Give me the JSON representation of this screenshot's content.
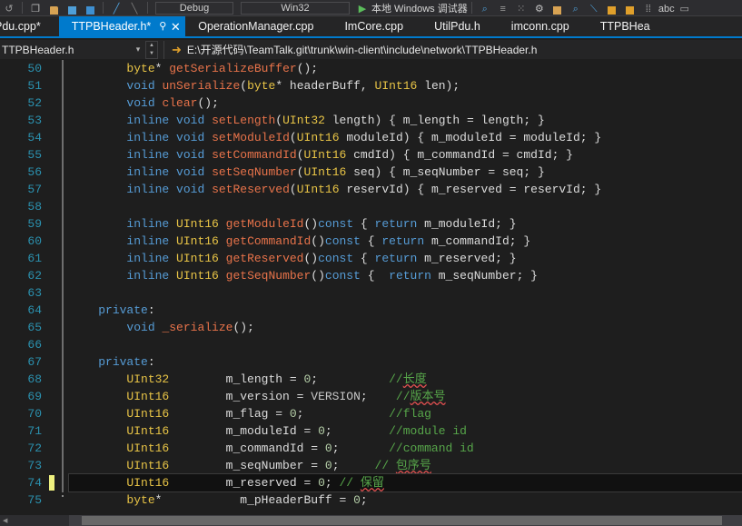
{
  "toolbar": {
    "configuration": "Debug",
    "platform": "Win32",
    "run_label": "本地 Windows 调试器",
    "icons": [
      "undo-icon",
      "redo-icon",
      "open-folder-icon",
      "save-icon",
      "save-all-icon",
      "cut-icon",
      "paste-icon",
      "navigate-backward-icon",
      "navigate-forward-icon",
      "find-icon",
      "bookmark-icon",
      "comment-icon",
      "uncomment-icon",
      "indent-icon",
      "outdent-icon",
      "toggle-whitespace-icon",
      "abc-icon",
      "window-icon"
    ]
  },
  "tabs": {
    "items": [
      {
        "label": "Pdu.cpp*",
        "active": false
      },
      {
        "label": "TTPBHeader.h*",
        "active": true
      },
      {
        "label": "OperationManager.cpp",
        "active": false
      },
      {
        "label": "ImCore.cpp",
        "active": false
      },
      {
        "label": "UtilPdu.h",
        "active": false
      },
      {
        "label": "imconn.cpp",
        "active": false
      },
      {
        "label": "TTPBHea",
        "active": false
      }
    ],
    "pin_glyph": "⚲",
    "close_glyph": "✕"
  },
  "navbar": {
    "file_selector": "TTPBHeader.h",
    "caret_glyph": "▾",
    "arrow_glyph": "➜",
    "path": "E:\\开源代码\\TeamTalk.git\\trunk\\win-client\\include\\network\\TTPBHeader.h"
  },
  "editor": {
    "current_line": 74,
    "first_line": 50,
    "lines": [
      {
        "n": 50,
        "rail": "bar",
        "changed": false,
        "tokens": [
          {
            "t": "        ",
            "c": "t-plain"
          },
          {
            "t": "byte",
            "c": "t-type"
          },
          {
            "t": "* ",
            "c": "t-punc"
          },
          {
            "t": "getSerializeBuffer",
            "c": "t-fn"
          },
          {
            "t": "();",
            "c": "t-punc"
          }
        ]
      },
      {
        "n": 51,
        "rail": "bar",
        "changed": false,
        "tokens": [
          {
            "t": "        ",
            "c": "t-plain"
          },
          {
            "t": "void",
            "c": "t-kw"
          },
          {
            "t": " ",
            "c": "t-plain"
          },
          {
            "t": "unSerialize",
            "c": "t-fn"
          },
          {
            "t": "(",
            "c": "t-punc"
          },
          {
            "t": "byte",
            "c": "t-type"
          },
          {
            "t": "* headerBuff, ",
            "c": "t-id"
          },
          {
            "t": "UInt16",
            "c": "t-type"
          },
          {
            "t": " len);",
            "c": "t-id"
          }
        ]
      },
      {
        "n": 52,
        "rail": "bar",
        "changed": false,
        "tokens": [
          {
            "t": "        ",
            "c": "t-plain"
          },
          {
            "t": "void",
            "c": "t-kw"
          },
          {
            "t": " ",
            "c": "t-plain"
          },
          {
            "t": "clear",
            "c": "t-fn"
          },
          {
            "t": "();",
            "c": "t-punc"
          }
        ]
      },
      {
        "n": 53,
        "rail": "bar",
        "changed": false,
        "tokens": [
          {
            "t": "        ",
            "c": "t-plain"
          },
          {
            "t": "inline",
            "c": "t-kw"
          },
          {
            "t": " ",
            "c": "t-plain"
          },
          {
            "t": "void",
            "c": "t-kw"
          },
          {
            "t": " ",
            "c": "t-plain"
          },
          {
            "t": "setLength",
            "c": "t-fn"
          },
          {
            "t": "(",
            "c": "t-punc"
          },
          {
            "t": "UInt32",
            "c": "t-type"
          },
          {
            "t": " length) { m_length = length; }",
            "c": "t-id"
          }
        ]
      },
      {
        "n": 54,
        "rail": "bar",
        "changed": false,
        "tokens": [
          {
            "t": "        ",
            "c": "t-plain"
          },
          {
            "t": "inline",
            "c": "t-kw"
          },
          {
            "t": " ",
            "c": "t-plain"
          },
          {
            "t": "void",
            "c": "t-kw"
          },
          {
            "t": " ",
            "c": "t-plain"
          },
          {
            "t": "setModuleId",
            "c": "t-fn"
          },
          {
            "t": "(",
            "c": "t-punc"
          },
          {
            "t": "UInt16",
            "c": "t-type"
          },
          {
            "t": " moduleId) { m_moduleId = moduleId; }",
            "c": "t-id"
          }
        ]
      },
      {
        "n": 55,
        "rail": "bar",
        "changed": false,
        "tokens": [
          {
            "t": "        ",
            "c": "t-plain"
          },
          {
            "t": "inline",
            "c": "t-kw"
          },
          {
            "t": " ",
            "c": "t-plain"
          },
          {
            "t": "void",
            "c": "t-kw"
          },
          {
            "t": " ",
            "c": "t-plain"
          },
          {
            "t": "setCommandId",
            "c": "t-fn"
          },
          {
            "t": "(",
            "c": "t-punc"
          },
          {
            "t": "UInt16",
            "c": "t-type"
          },
          {
            "t": " cmdId) { m_commandId = cmdId; }",
            "c": "t-id"
          }
        ]
      },
      {
        "n": 56,
        "rail": "bar",
        "changed": false,
        "tokens": [
          {
            "t": "        ",
            "c": "t-plain"
          },
          {
            "t": "inline",
            "c": "t-kw"
          },
          {
            "t": " ",
            "c": "t-plain"
          },
          {
            "t": "void",
            "c": "t-kw"
          },
          {
            "t": " ",
            "c": "t-plain"
          },
          {
            "t": "setSeqNumber",
            "c": "t-fn"
          },
          {
            "t": "(",
            "c": "t-punc"
          },
          {
            "t": "UInt16",
            "c": "t-type"
          },
          {
            "t": " seq) { m_seqNumber = seq; }",
            "c": "t-id"
          }
        ]
      },
      {
        "n": 57,
        "rail": "bar",
        "changed": false,
        "tokens": [
          {
            "t": "        ",
            "c": "t-plain"
          },
          {
            "t": "inline",
            "c": "t-kw"
          },
          {
            "t": " ",
            "c": "t-plain"
          },
          {
            "t": "void",
            "c": "t-kw"
          },
          {
            "t": " ",
            "c": "t-plain"
          },
          {
            "t": "setReserved",
            "c": "t-fn"
          },
          {
            "t": "(",
            "c": "t-punc"
          },
          {
            "t": "UInt16",
            "c": "t-type"
          },
          {
            "t": " reservId) { m_reserved = reservId; }",
            "c": "t-id"
          }
        ]
      },
      {
        "n": 58,
        "rail": "bar",
        "changed": false,
        "tokens": []
      },
      {
        "n": 59,
        "rail": "bar",
        "changed": false,
        "tokens": [
          {
            "t": "        ",
            "c": "t-plain"
          },
          {
            "t": "inline",
            "c": "t-kw"
          },
          {
            "t": " ",
            "c": "t-plain"
          },
          {
            "t": "UInt16",
            "c": "t-type"
          },
          {
            "t": " ",
            "c": "t-plain"
          },
          {
            "t": "getModuleId",
            "c": "t-fn"
          },
          {
            "t": "()",
            "c": "t-punc"
          },
          {
            "t": "const",
            "c": "t-kw"
          },
          {
            "t": " { ",
            "c": "t-punc"
          },
          {
            "t": "return",
            "c": "t-kw"
          },
          {
            "t": " m_moduleId; }",
            "c": "t-id"
          }
        ]
      },
      {
        "n": 60,
        "rail": "bar",
        "changed": false,
        "tokens": [
          {
            "t": "        ",
            "c": "t-plain"
          },
          {
            "t": "inline",
            "c": "t-kw"
          },
          {
            "t": " ",
            "c": "t-plain"
          },
          {
            "t": "UInt16",
            "c": "t-type"
          },
          {
            "t": " ",
            "c": "t-plain"
          },
          {
            "t": "getCommandId",
            "c": "t-fn"
          },
          {
            "t": "()",
            "c": "t-punc"
          },
          {
            "t": "const",
            "c": "t-kw"
          },
          {
            "t": " { ",
            "c": "t-punc"
          },
          {
            "t": "return",
            "c": "t-kw"
          },
          {
            "t": " m_commandId; }",
            "c": "t-id"
          }
        ]
      },
      {
        "n": 61,
        "rail": "bar",
        "changed": false,
        "tokens": [
          {
            "t": "        ",
            "c": "t-plain"
          },
          {
            "t": "inline",
            "c": "t-kw"
          },
          {
            "t": " ",
            "c": "t-plain"
          },
          {
            "t": "UInt16",
            "c": "t-type"
          },
          {
            "t": " ",
            "c": "t-plain"
          },
          {
            "t": "getReserved",
            "c": "t-fn"
          },
          {
            "t": "()",
            "c": "t-punc"
          },
          {
            "t": "const",
            "c": "t-kw"
          },
          {
            "t": " { ",
            "c": "t-punc"
          },
          {
            "t": "return",
            "c": "t-kw"
          },
          {
            "t": " m_reserved; }",
            "c": "t-id"
          }
        ]
      },
      {
        "n": 62,
        "rail": "bar",
        "changed": false,
        "tokens": [
          {
            "t": "        ",
            "c": "t-plain"
          },
          {
            "t": "inline",
            "c": "t-kw"
          },
          {
            "t": " ",
            "c": "t-plain"
          },
          {
            "t": "UInt16",
            "c": "t-type"
          },
          {
            "t": " ",
            "c": "t-plain"
          },
          {
            "t": "getSeqNumber",
            "c": "t-fn"
          },
          {
            "t": "()",
            "c": "t-punc"
          },
          {
            "t": "const",
            "c": "t-kw"
          },
          {
            "t": " {  ",
            "c": "t-punc"
          },
          {
            "t": "return",
            "c": "t-kw"
          },
          {
            "t": " m_seqNumber; }",
            "c": "t-id"
          }
        ]
      },
      {
        "n": 63,
        "rail": "bar",
        "changed": false,
        "tokens": []
      },
      {
        "n": 64,
        "rail": "bar",
        "changed": false,
        "tokens": [
          {
            "t": "    ",
            "c": "t-plain"
          },
          {
            "t": "private",
            "c": "t-kw"
          },
          {
            "t": ":",
            "c": "t-punc"
          }
        ]
      },
      {
        "n": 65,
        "rail": "bar",
        "changed": false,
        "tokens": [
          {
            "t": "        ",
            "c": "t-plain"
          },
          {
            "t": "void",
            "c": "t-kw"
          },
          {
            "t": " ",
            "c": "t-plain"
          },
          {
            "t": "_serialize",
            "c": "t-fn"
          },
          {
            "t": "();",
            "c": "t-punc"
          }
        ]
      },
      {
        "n": 66,
        "rail": "bar",
        "changed": false,
        "tokens": []
      },
      {
        "n": 67,
        "rail": "bar",
        "changed": false,
        "tokens": [
          {
            "t": "    ",
            "c": "t-plain"
          },
          {
            "t": "private",
            "c": "t-kw"
          },
          {
            "t": ":",
            "c": "t-punc"
          }
        ]
      },
      {
        "n": 68,
        "rail": "bar",
        "changed": false,
        "tokens": [
          {
            "t": "        ",
            "c": "t-plain"
          },
          {
            "t": "UInt32",
            "c": "t-type"
          },
          {
            "t": "        m_length = ",
            "c": "t-id"
          },
          {
            "t": "0",
            "c": "t-num"
          },
          {
            "t": ";",
            "c": "t-punc"
          },
          {
            "t": "          ",
            "c": "t-plain"
          },
          {
            "t": "//",
            "c": "t-cmt"
          },
          {
            "t": "长度",
            "c": "t-cmt",
            "squiggle": true
          }
        ]
      },
      {
        "n": 69,
        "rail": "bar",
        "changed": false,
        "tokens": [
          {
            "t": "        ",
            "c": "t-plain"
          },
          {
            "t": "UInt16",
            "c": "t-type"
          },
          {
            "t": "        m_version = ",
            "c": "t-id"
          },
          {
            "t": "VERSION",
            "c": "t-macro"
          },
          {
            "t": ";",
            "c": "t-punc"
          },
          {
            "t": "    ",
            "c": "t-plain"
          },
          {
            "t": "//",
            "c": "t-cmt"
          },
          {
            "t": "版本号",
            "c": "t-cmt",
            "squiggle": true
          }
        ]
      },
      {
        "n": 70,
        "rail": "bar",
        "changed": false,
        "tokens": [
          {
            "t": "        ",
            "c": "t-plain"
          },
          {
            "t": "UInt16",
            "c": "t-type"
          },
          {
            "t": "        m_flag = ",
            "c": "t-id"
          },
          {
            "t": "0",
            "c": "t-num"
          },
          {
            "t": ";",
            "c": "t-punc"
          },
          {
            "t": "            ",
            "c": "t-plain"
          },
          {
            "t": "//flag",
            "c": "t-cmt"
          }
        ]
      },
      {
        "n": 71,
        "rail": "bar",
        "changed": false,
        "tokens": [
          {
            "t": "        ",
            "c": "t-plain"
          },
          {
            "t": "UInt16",
            "c": "t-type"
          },
          {
            "t": "        m_moduleId = ",
            "c": "t-id"
          },
          {
            "t": "0",
            "c": "t-num"
          },
          {
            "t": ";",
            "c": "t-punc"
          },
          {
            "t": "        ",
            "c": "t-plain"
          },
          {
            "t": "//module id",
            "c": "t-cmt"
          }
        ]
      },
      {
        "n": 72,
        "rail": "bar",
        "changed": false,
        "tokens": [
          {
            "t": "        ",
            "c": "t-plain"
          },
          {
            "t": "UInt16",
            "c": "t-type"
          },
          {
            "t": "        m_commandId = ",
            "c": "t-id"
          },
          {
            "t": "0",
            "c": "t-num"
          },
          {
            "t": ";",
            "c": "t-punc"
          },
          {
            "t": "       ",
            "c": "t-plain"
          },
          {
            "t": "//command id",
            "c": "t-cmt"
          }
        ]
      },
      {
        "n": 73,
        "rail": "bar",
        "changed": false,
        "tokens": [
          {
            "t": "        ",
            "c": "t-plain"
          },
          {
            "t": "UInt16",
            "c": "t-type"
          },
          {
            "t": "        m_seqNumber = ",
            "c": "t-id"
          },
          {
            "t": "0",
            "c": "t-num"
          },
          {
            "t": ";",
            "c": "t-punc"
          },
          {
            "t": "     ",
            "c": "t-plain"
          },
          {
            "t": "// ",
            "c": "t-cmt"
          },
          {
            "t": "包序号",
            "c": "t-cmt",
            "squiggle": true
          }
        ]
      },
      {
        "n": 74,
        "rail": "bar",
        "changed": true,
        "current": true,
        "tokens": [
          {
            "t": "        ",
            "c": "t-plain"
          },
          {
            "t": "UInt16",
            "c": "t-type"
          },
          {
            "t": "        m_reserved = ",
            "c": "t-id"
          },
          {
            "t": "0",
            "c": "t-num"
          },
          {
            "t": "; ",
            "c": "t-punc"
          },
          {
            "t": "// ",
            "c": "t-cmt"
          },
          {
            "t": "保留",
            "c": "t-cmt",
            "squiggle": true
          }
        ]
      },
      {
        "n": 75,
        "rail": "dot",
        "changed": false,
        "tokens": [
          {
            "t": "        ",
            "c": "t-plain"
          },
          {
            "t": "byte",
            "c": "t-type"
          },
          {
            "t": "*",
            "c": "t-punc"
          },
          {
            "t": "           m_pHeaderBuff = ",
            "c": "t-id"
          },
          {
            "t": "0",
            "c": "t-num"
          },
          {
            "t": ";",
            "c": "t-punc"
          }
        ]
      }
    ]
  },
  "scrollbar": {
    "left_arrow": "◀",
    "right_arrow": "▶"
  }
}
